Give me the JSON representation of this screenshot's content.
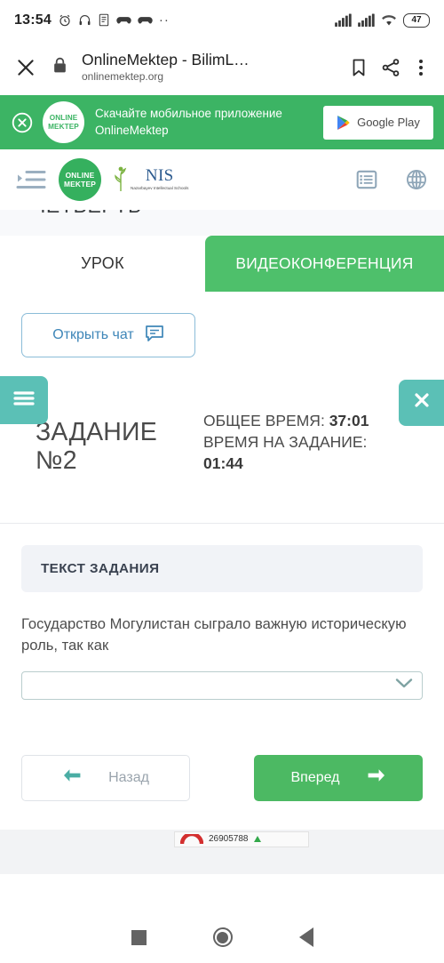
{
  "status_bar": {
    "time": "13:54",
    "icons": [
      "alarm-clock-icon",
      "headphones-icon",
      "document-icon",
      "game-controller-icon",
      "game-controller-icon"
    ],
    "overflow_dots": "··",
    "battery_level": "47"
  },
  "browser": {
    "close_icon": "close-icon",
    "lock_icon": "lock-icon",
    "page_title": "OnlineMektep - BilimL…",
    "page_url": "onlinemektep.org",
    "bookmark_icon": "bookmark-icon",
    "share_icon": "share-icon",
    "menu_icon": "more-vertical-icon"
  },
  "promo_banner": {
    "close_icon": "close-circle-icon",
    "logo_line1": "ONLINE",
    "logo_line2": "MEKTEP",
    "message": "Скачайте мобильное приложение OnlineMektep",
    "store_button_label": "Google Play",
    "background_color": "#3cb464"
  },
  "site_header": {
    "menu_icon": "indent-menu-icon",
    "brand_line1": "ONLINE",
    "brand_line2": "MEKTEP",
    "nis_abbr": "NIS",
    "nis_sub": "Nazarbayev\nIntellectual\nSchools",
    "list_icon": "list-view-icon",
    "language_icon": "globe-icon"
  },
  "cutoff_heading": "ЧЕТВЕРТЬ",
  "tabs": [
    {
      "label": "УРОК",
      "active": false
    },
    {
      "label": "ВИДЕОКОНФЕРЕНЦИЯ",
      "active": true
    }
  ],
  "chat": {
    "button_label": "Открыть чат",
    "icon": "chat-bubble-icon"
  },
  "task_bar": {
    "menu_icon": "hamburger-icon",
    "close_icon": "close-icon",
    "title_line1": "ЗАДАНИЕ",
    "title_line2": "№2",
    "total_time_label": "ОБЩЕЕ ВРЕМЯ:",
    "total_time_value": "37:01",
    "task_time_label": "ВРЕМЯ НА ЗАДАНИЕ:",
    "task_time_value": "01:44",
    "accent_color": "#5bc0b6"
  },
  "task": {
    "section_title": "ТЕКСТ ЗАДАНИЯ",
    "question": "Государство Могулистан сыграло важную историческую роль, так как",
    "answer_value": "",
    "answer_placeholder": "",
    "dropdown_icon": "chevron-down-icon"
  },
  "nav_buttons": {
    "back_label": "Назад",
    "back_icon": "arrow-left-icon",
    "forward_label": "Вперед",
    "forward_icon": "arrow-right-icon",
    "forward_color": "#4cb963"
  },
  "footer_counter": {
    "value": "26905788",
    "logo_icon": "counter-arc-icon"
  },
  "android_nav": {
    "recents_icon": "square-recents-icon",
    "home_icon": "circle-home-icon",
    "back_icon": "triangle-back-icon"
  }
}
